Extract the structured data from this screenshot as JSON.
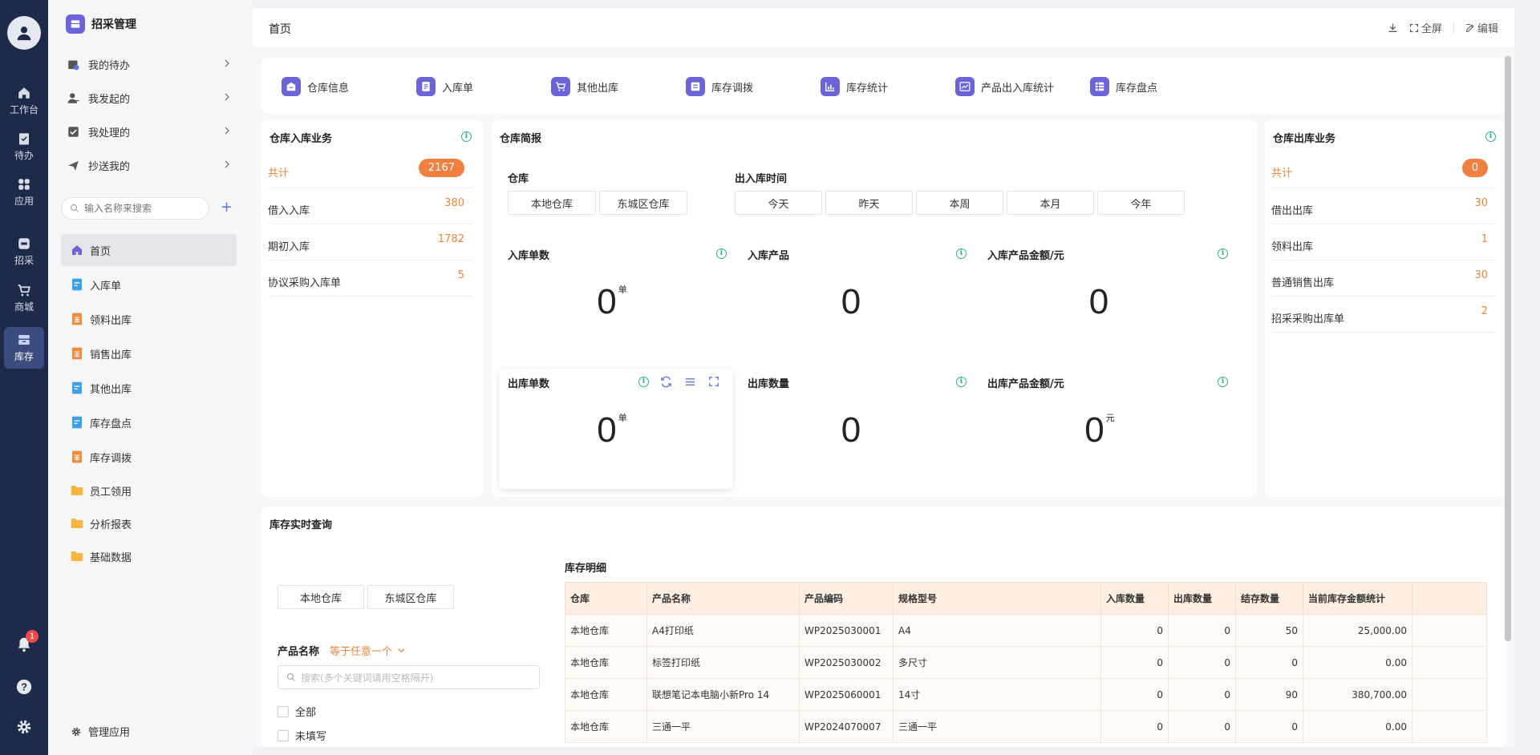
{
  "rail": {
    "items": [
      {
        "label": "工作台",
        "icon": "home-icon"
      },
      {
        "label": "待办",
        "icon": "clipboard-icon"
      },
      {
        "label": "应用",
        "icon": "apps-icon"
      },
      {
        "label": "招采",
        "icon": "sim-icon"
      },
      {
        "label": "商城",
        "icon": "cart-icon"
      },
      {
        "label": "库存",
        "icon": "inventory-icon"
      }
    ],
    "notification_count": "1"
  },
  "side": {
    "app_title": "招采管理",
    "groups": [
      {
        "label": "我的待办"
      },
      {
        "label": "我发起的"
      },
      {
        "label": "我处理的"
      },
      {
        "label": "抄送我的"
      }
    ],
    "search_placeholder": "输入名称来搜索",
    "nav": [
      {
        "label": "首页"
      },
      {
        "label": "入库单"
      },
      {
        "label": "领料出库"
      },
      {
        "label": "销售出库"
      },
      {
        "label": "其他出库"
      },
      {
        "label": "库存盘点"
      },
      {
        "label": "库存调拨"
      },
      {
        "label": "员工领用"
      },
      {
        "label": "分析报表"
      },
      {
        "label": "基础数据"
      }
    ],
    "manage_label": "管理应用"
  },
  "header": {
    "title": "首页",
    "fullscreen_label": "全屏",
    "edit_label": "编辑"
  },
  "quick": [
    {
      "label": "仓库信息"
    },
    {
      "label": "入库单"
    },
    {
      "label": "其他出库"
    },
    {
      "label": "库存调拨"
    },
    {
      "label": "库存统计"
    },
    {
      "label": "产品出入库统计"
    },
    {
      "label": "库存盘点"
    }
  ],
  "inbound": {
    "title": "仓库入库业务",
    "rows": [
      {
        "label": "共计",
        "value": "2167"
      },
      {
        "label": "借入入库",
        "value": "380"
      },
      {
        "label": "期初入库",
        "value": "1782"
      },
      {
        "label": "协议采购入库单",
        "value": "5"
      }
    ]
  },
  "brief": {
    "title": "仓库简报",
    "warehouse_label": "仓库",
    "warehouses": [
      "本地仓库",
      "东城区仓库"
    ],
    "time_label": "出入库时间",
    "times": [
      "今天",
      "昨天",
      "本周",
      "本月",
      "今年"
    ],
    "metrics": [
      {
        "title": "入库单数",
        "value": "0",
        "unit": "单"
      },
      {
        "title": "入库产品",
        "value": "0",
        "unit": ""
      },
      {
        "title": "入库产品金额/元",
        "value": "0",
        "unit": ""
      },
      {
        "title": "出库单数",
        "value": "0",
        "unit": "单"
      },
      {
        "title": "出库数量",
        "value": "0",
        "unit": ""
      },
      {
        "title": "出库产品金额/元",
        "value": "0",
        "unit": "元"
      }
    ]
  },
  "outbound": {
    "title": "仓库出库业务",
    "rows": [
      {
        "label": "共计",
        "value": "0"
      },
      {
        "label": "借出出库",
        "value": "30"
      },
      {
        "label": "领料出库",
        "value": "1"
      },
      {
        "label": "普通销售出库",
        "value": "30"
      },
      {
        "label": "招采采购出库单",
        "value": "2"
      }
    ]
  },
  "stock": {
    "title": "库存实时查询",
    "warehouses": [
      "本地仓库",
      "东城区仓库"
    ],
    "filter_label": "产品名称",
    "filter_op": "等于任意一个",
    "search_placeholder": "搜索(多个关键词请用空格隔开)",
    "options": [
      "全部",
      "未填写"
    ],
    "detail_title": "库存明细",
    "columns": [
      "仓库",
      "产品名称",
      "产品编码",
      "规格型号",
      "入库数量",
      "出库数量",
      "结存数量",
      "当前库存金额统计",
      ""
    ],
    "rows": [
      [
        "本地仓库",
        "A4打印纸",
        "WP2025030001",
        "A4",
        "0",
        "0",
        "50",
        "25,000.00",
        ""
      ],
      [
        "本地仓库",
        "标签打印纸",
        "WP2025030002",
        "多尺寸",
        "0",
        "0",
        "0",
        "0.00",
        ""
      ],
      [
        "本地仓库",
        "联想笔记本电脑小新Pro 14",
        "WP2025060001",
        "14寸",
        "0",
        "0",
        "90",
        "380,700.00",
        ""
      ],
      [
        "本地仓库",
        "三通一平",
        "WP2024070007",
        "三通一平",
        "0",
        "0",
        "0",
        "0.00",
        ""
      ]
    ]
  }
}
